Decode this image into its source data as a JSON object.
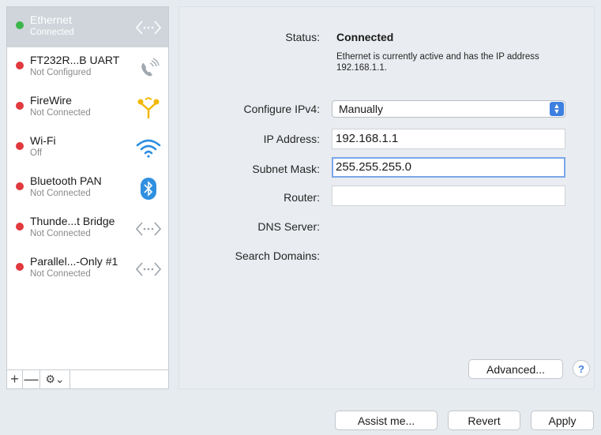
{
  "services": [
    {
      "name": "Ethernet",
      "status": "Connected",
      "status_color": "#3cb54a",
      "icon": "ethernet-arrows-icon",
      "selected": true
    },
    {
      "name": "FT232R...B UART",
      "status": "Not Configured",
      "status_color": "#e0393e",
      "icon": "phone-modem-icon"
    },
    {
      "name": "FireWire",
      "status": "Not Connected",
      "status_color": "#e0393e",
      "icon": "firewire-icon"
    },
    {
      "name": "Wi-Fi",
      "status": "Off",
      "status_color": "#e0393e",
      "icon": "wifi-icon"
    },
    {
      "name": "Bluetooth PAN",
      "status": "Not Connected",
      "status_color": "#e0393e",
      "icon": "bluetooth-icon"
    },
    {
      "name": "Thunde...t Bridge",
      "status": "Not Connected",
      "status_color": "#e0393e",
      "icon": "ethernet-arrows-icon"
    },
    {
      "name": "Parallel...-Only #1",
      "status": "Not Connected",
      "status_color": "#e0393e",
      "icon": "ethernet-arrows-icon"
    }
  ],
  "toolbar": {
    "add": "+",
    "remove": "—",
    "gear": "⚙︎⌄"
  },
  "detail": {
    "status_label": "Status:",
    "status_value": "Connected",
    "status_description": "Ethernet is currently active and has the IP address 192.168.1.1.",
    "configure_label": "Configure IPv4:",
    "configure_value": "Manually",
    "ip_label": "IP Address:",
    "ip_value": "192.168.1.1",
    "subnet_label": "Subnet Mask:",
    "subnet_value": "255.255.255.0",
    "router_label": "Router:",
    "router_value": "",
    "dns_label": "DNS Server:",
    "search_label": "Search Domains:",
    "advanced_label": "Advanced...",
    "help_label": "?"
  },
  "footer": {
    "assist": "Assist me...",
    "revert": "Revert",
    "apply": "Apply"
  },
  "colors": {
    "accent": "#3d7fe0",
    "connected": "#3cb54a",
    "disconnected": "#e0393e",
    "firewire": "#f2b807"
  }
}
